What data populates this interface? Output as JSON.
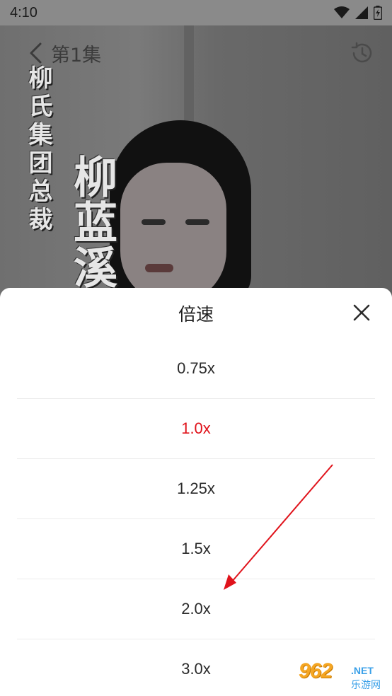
{
  "status_bar": {
    "time": "4:10"
  },
  "player": {
    "episode_title": "第1集",
    "back_icon": "chevron-left-icon",
    "history_icon": "history-clock-icon",
    "overlay_text_small": "柳氏集团总裁",
    "overlay_text_big": "柳蓝溪"
  },
  "speed_sheet": {
    "title": "倍速",
    "close_icon": "close-icon",
    "options": [
      {
        "label": "0.75x",
        "selected": false
      },
      {
        "label": "1.0x",
        "selected": true
      },
      {
        "label": "1.25x",
        "selected": false
      },
      {
        "label": "1.5x",
        "selected": false
      },
      {
        "label": "2.0x",
        "selected": false
      },
      {
        "label": "3.0x",
        "selected": false
      }
    ],
    "selected_color": "#e0131b"
  },
  "annotation": {
    "arrow_color": "#e0131b"
  },
  "watermark": {
    "number": "962",
    "domain": ".NET",
    "name": "乐游网"
  }
}
